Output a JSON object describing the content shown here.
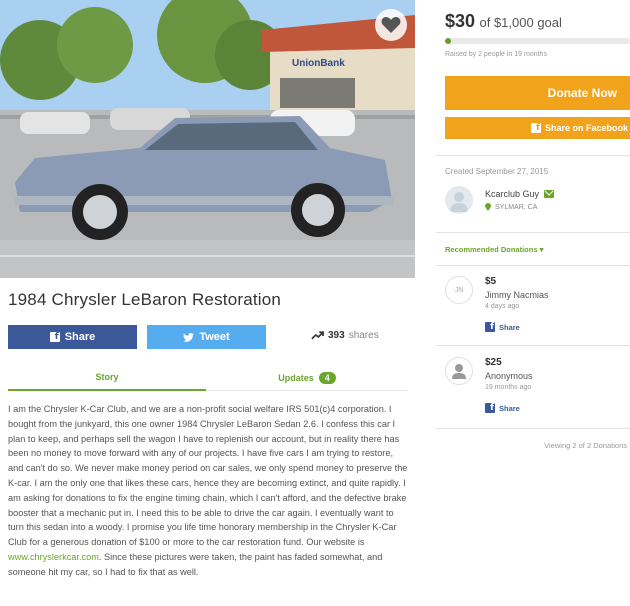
{
  "campaign": {
    "title": "1984 Chrysler LeBaron Restoration",
    "photo": {
      "sign_text": "UnionBank"
    }
  },
  "share": {
    "facebook_label": "Share",
    "tweet_label": "Tweet",
    "share_count": "393",
    "share_count_label": "shares"
  },
  "tabs": {
    "story_label": "Story",
    "updates_label": "Updates",
    "updates_count": "4"
  },
  "story": {
    "text_before_link": "I am the Chrysler K-Car Club, and we are a non-profit social welfare IRS 501(c)4 corporation. I bought from the junkyard, this one owner 1984 Chrysler LeBaron Sedan 2.6. I confess this car I plan to keep, and perhaps sell the wagon I have to replenish our account, but in reality there has been no money to move forward with any of our projects.  I have five cars I am trying to restore, and can't do so. We never make money period on car sales, we only spend money to preserve the K-car. I am the only one that likes these cars, hence they are becoming extinct, and quite rapidly. I am asking for donations to fix the engine timing chain, which I can't afford, and the defective brake booster that a mechanic put in. I need this to be able to drive the car again.  I eventually want to turn this sedan into a woody.  I promise you life time honorary membership in the Chrysler K-Car Club for a generous donation of $100 or more to the car restoration fund. Our website is ",
    "link_text": "www.chryslerkcar.com",
    "text_after_link": ". Since these pictures were taken, the paint has faded somewhat, and someone hit my car, so I had to fix that as well."
  },
  "funding": {
    "amount_raised": "$30",
    "goal_text": "of $1,000 goal",
    "progress_fraction": 0.03,
    "raised_by_text": "Raised by 2 people in 19 months",
    "donate_label": "Donate Now",
    "facebook_share_label": "Share on Facebook"
  },
  "organizer": {
    "created_text": "Created September 27, 2015",
    "name": "Kcarclub Guy",
    "location": "SYLMAR, CA"
  },
  "donations": {
    "header": "Recommended Donations",
    "items": [
      {
        "initials": "JN",
        "amount": "$5",
        "name": "Jimmy Nacmias",
        "time": "4 days ago",
        "share_label": "Share"
      },
      {
        "initials": "",
        "amount": "$25",
        "name": "Anonymous",
        "time": "19 months ago",
        "share_label": "Share"
      }
    ],
    "viewing_text": "Viewing 2 of 2 Donations"
  },
  "colors": {
    "accent_green": "#6aa62a",
    "donate_orange": "#f2a31c",
    "facebook_blue": "#3b5998",
    "twitter_blue": "#55acee"
  },
  "icons": [
    "heart-icon",
    "facebook-icon",
    "twitter-icon",
    "trending-icon",
    "caret-down-icon",
    "verified-mail-icon",
    "location-pin-icon",
    "person-icon"
  ]
}
